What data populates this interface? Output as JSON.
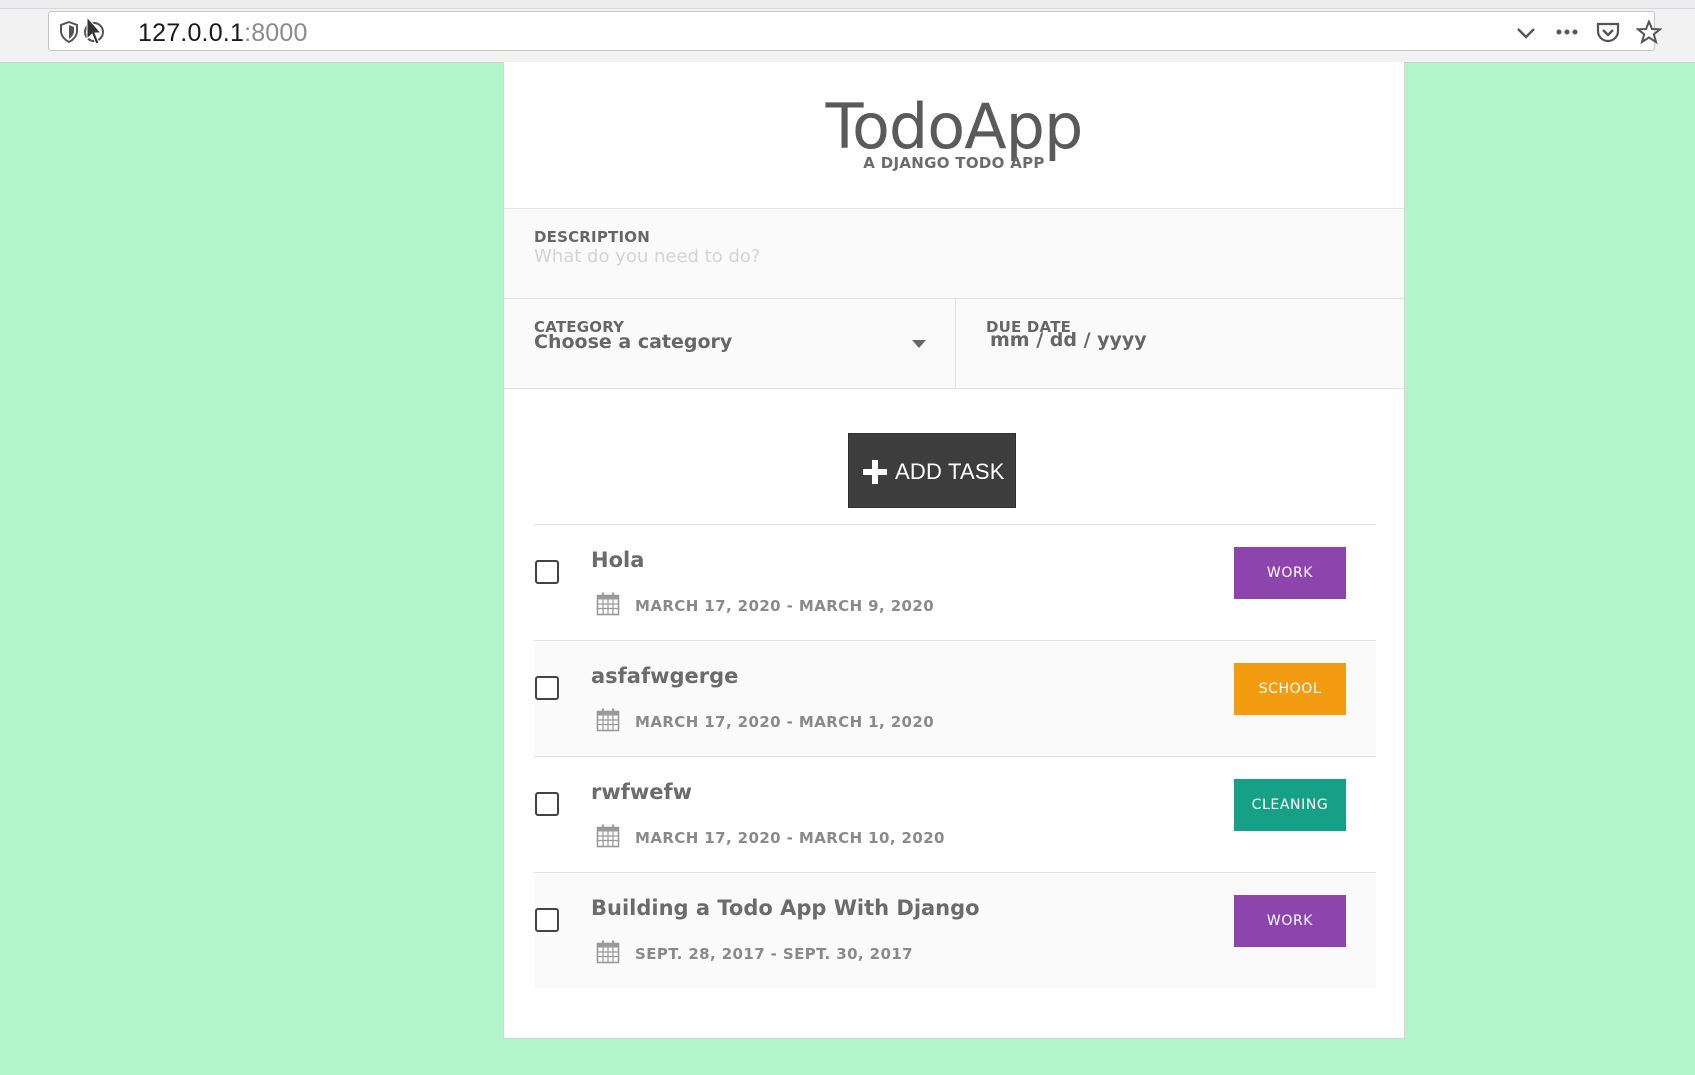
{
  "browser": {
    "url_host": "127.0.0.1",
    "url_port": ":8000"
  },
  "app": {
    "title": "TodoApp",
    "subtitle": "A DJANGO TODO APP"
  },
  "form": {
    "description_label": "DESCRIPTION",
    "description_placeholder": "What do you need to do?",
    "category_label": "CATEGORY",
    "category_value": "Choose a category",
    "due_date_label": "DUE DATE",
    "due_date_value": "mm / dd / yyyy",
    "add_button_label": "ADD TASK"
  },
  "colors": {
    "page_bg": "#b2f5cb",
    "work": "#8e44ad",
    "school": "#f39c12",
    "cleaning": "#16a085"
  },
  "tasks": [
    {
      "title": "Hola",
      "dates": "MARCH 17, 2020 - MARCH 9, 2020",
      "category": "WORK",
      "color": "#8e44ad"
    },
    {
      "title": "asfafwgerge",
      "dates": "MARCH 17, 2020 - MARCH 1, 2020",
      "category": "SCHOOL",
      "color": "#f39c12"
    },
    {
      "title": "rwfwefw",
      "dates": "MARCH 17, 2020 - MARCH 10, 2020",
      "category": "CLEANING",
      "color": "#16a085"
    },
    {
      "title": "Building a Todo App With Django",
      "dates": "SEPT. 28, 2017 - SEPT. 30, 2017",
      "category": "WORK",
      "color": "#8e44ad"
    }
  ]
}
